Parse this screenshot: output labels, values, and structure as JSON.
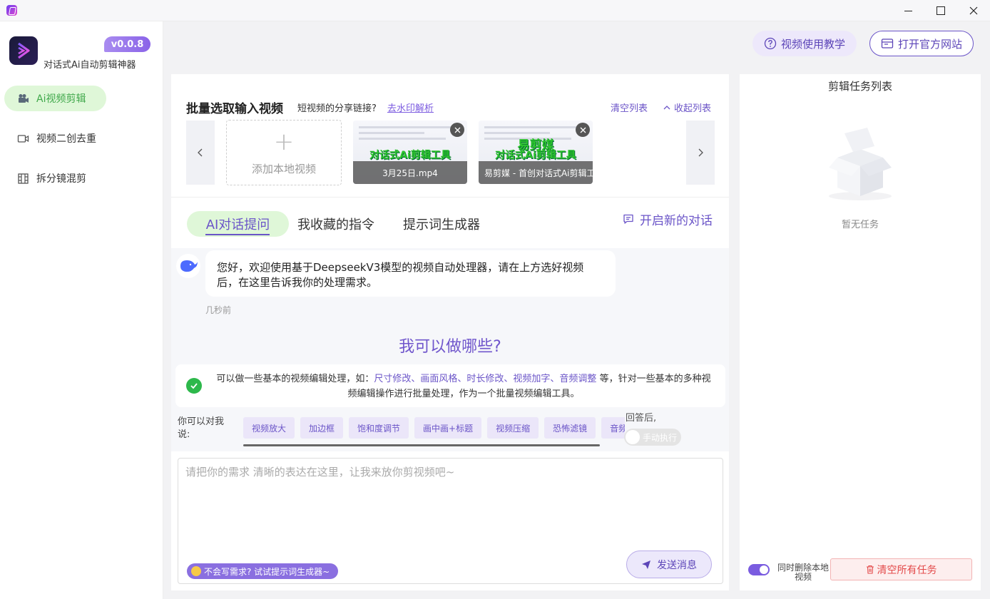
{
  "app": {
    "version": "v0.0.8",
    "name": "对话式Ai自动剪辑神器"
  },
  "nav": {
    "items": [
      {
        "label": "Ai视频剪辑",
        "icon": "video-camera-icon",
        "active": true
      },
      {
        "label": "视频二创去重",
        "icon": "video-icon",
        "active": false
      },
      {
        "label": "拆分镜混剪",
        "icon": "film-grid-icon",
        "active": false
      }
    ]
  },
  "header": {
    "tutorial_label": "视频使用教学",
    "site_label": "打开官方网站"
  },
  "batch": {
    "title": "批量选取输入视频",
    "share_question": "短视频的分享链接?",
    "share_link": "去水印解析",
    "clear_list": "清空列表",
    "collapse_list": "收起列表",
    "add_local": "添加本地视频",
    "videos": [
      {
        "name": "3月25日.mp4",
        "overlay": "对话式Ai剪辑工具"
      },
      {
        "name": "易剪媒 - 首创对话式Ai剪辑工具",
        "overlay": "对话式Ai剪辑工具",
        "brand": "易剪媒"
      }
    ]
  },
  "tabs": {
    "chat": "AI对话提问",
    "favorites": "我收藏的指令",
    "generator": "提示词生成器",
    "new_chat": "开启新的对话"
  },
  "chat": {
    "greeting": "您好，欢迎使用基于DeepseekV3模型的视频自动处理器，请在上方选好视频后，在这里告诉我你的处理需求。",
    "time": "几秒前",
    "can_do_title": "我可以做哪些?",
    "info_prefix": "可以做一些基本的视频编辑处理，如：",
    "info_highlights": "尺寸修改、画面风格、时长修改、视频加字、音频调整",
    "info_suffix": " 等，针对一些基本的多种视频编辑操作进行批量处理，作为一个批量视频编辑工具。",
    "say_label": "你可以对我说:",
    "chips": [
      "视频放大",
      "加边框",
      "饱和度调节",
      "画中画+标题",
      "视频压缩",
      "恐怖滤镜",
      "音频"
    ],
    "after_label": "回答后,",
    "manual_toggle": "手动执行"
  },
  "input": {
    "placeholder": "请把你的需求 清晰的表达在这里，让我来放你剪视频吧~",
    "value": "",
    "hint": "不会写需求? 试试提示词生成器~",
    "send_label": "发送消息"
  },
  "tasks": {
    "title": "剪辑任务列表",
    "empty": "暂无任务",
    "delete_local_label": "同时删除本地视频",
    "delete_local_on": true,
    "clear_all": "清空所有任务"
  },
  "colors": {
    "accent": "#6b55c8",
    "active_nav_bg": "#dff7d8",
    "active_nav_text": "#3fa84a",
    "danger": "#e34a4a"
  }
}
